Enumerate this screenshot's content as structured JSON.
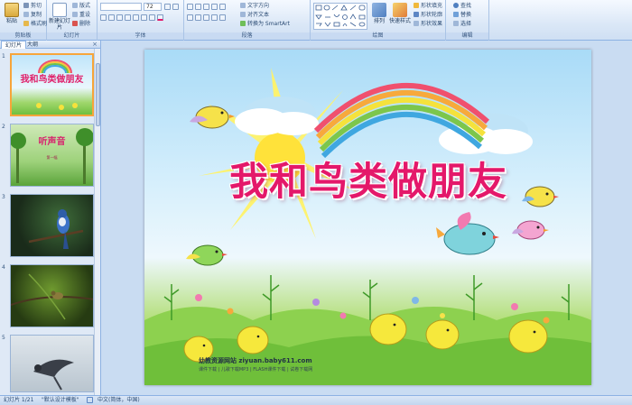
{
  "ribbon": {
    "clipboard": {
      "paste": "粘贴",
      "cut": "剪切",
      "copy": "复制",
      "format_painter": "格式刷",
      "label": "剪贴板"
    },
    "slides": {
      "new_slide": "新建幻灯片",
      "layout": "版式",
      "reset": "重设",
      "delete": "删除",
      "label": "幻灯片"
    },
    "font": {
      "font_name": "",
      "font_size": "72",
      "label": "字体"
    },
    "paragraph": {
      "text_direction": "文字方向",
      "align_text": "对齐文本",
      "convert_smartart": "转换为 SmartArt",
      "label": "段落"
    },
    "drawing": {
      "arrange": "排列",
      "quick_styles": "快速样式",
      "shape_fill": "形状填充",
      "shape_outline": "形状轮廓",
      "shape_effects": "形状效果",
      "label": "绘图"
    },
    "editing": {
      "find": "查找",
      "replace": "替换",
      "select": "选择",
      "label": "编辑"
    }
  },
  "panel": {
    "tab_slides": "幻灯片",
    "tab_outline": "大纲",
    "close": "×",
    "slides": [
      {
        "num": "1",
        "title": "我和鸟类做朋友"
      },
      {
        "num": "2",
        "title": "听声音",
        "subtitle": "第一幅"
      },
      {
        "num": "3",
        "title": ""
      },
      {
        "num": "4",
        "title": ""
      },
      {
        "num": "5",
        "title": ""
      }
    ]
  },
  "slide": {
    "title": "我和鸟类做朋友",
    "watermark": "幼教资源网站 ziyuan.baby611.com",
    "watermark_sub": "课件下载 | 儿歌下载MP3 | FLASH课件下载 | 试卷下载网"
  },
  "status": {
    "slide_count": "幻灯片 1/21",
    "theme": "\"默认设计模板\"",
    "language": "中文(简体，中国)"
  },
  "colors": {
    "title": "#e4186a",
    "ribbon_border": "#8db2e3",
    "selected_thumb": "#f7a53a"
  }
}
